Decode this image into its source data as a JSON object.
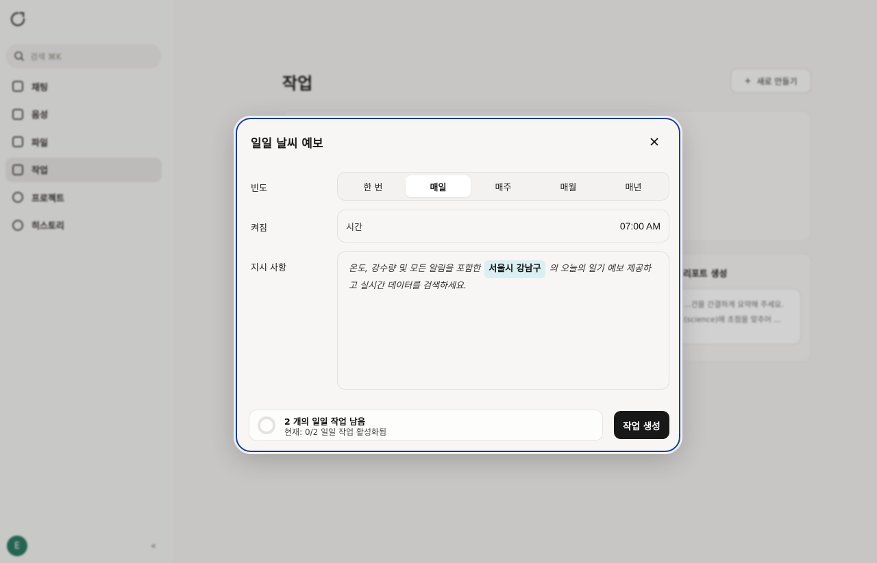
{
  "sidebar": {
    "search_placeholder": "검색 ⌘K",
    "items": [
      {
        "label": "채팅",
        "icon": "edit-icon"
      },
      {
        "label": "음성",
        "icon": "waveform-icon"
      },
      {
        "label": "파일",
        "icon": "file-icon"
      },
      {
        "label": "작업",
        "icon": "tasks-icon",
        "active": true
      },
      {
        "label": "프로젝트",
        "icon": "folder-icon"
      },
      {
        "label": "히스토리",
        "icon": "history-icon"
      }
    ],
    "avatar_initial": "E",
    "collapse_glyph": "«"
  },
  "main": {
    "title": "작업",
    "new_button": "새로 만들기",
    "card2_title": "리포트 생성",
    "card2_lines": [
      "...건을 간결하게 요약해 주세요.",
      "(science)에 초점을 맞추어 ..."
    ]
  },
  "modal": {
    "title": "일일 날씨 예보",
    "frequency": {
      "label": "빈도",
      "options": [
        "한 번",
        "매일",
        "매주",
        "매월",
        "매년"
      ],
      "selected": "매일"
    },
    "schedule": {
      "label": "켜짐",
      "time_label": "시간",
      "time_value": "07:00 AM"
    },
    "instructions": {
      "label": "지시 사항",
      "text_before": "온도, 강수량 및 모든 알림을 포함한",
      "location_chip": "서울시 강남구",
      "text_after": "의 오늘의 일기 예보 제공하고 실시간 데이터를 검색하세요."
    },
    "quota": {
      "title": "2 개의 일일 작업 남음",
      "subtitle": "현재: 0/2 일일 작업 활성화됨"
    },
    "create_button": "작업 생성"
  }
}
